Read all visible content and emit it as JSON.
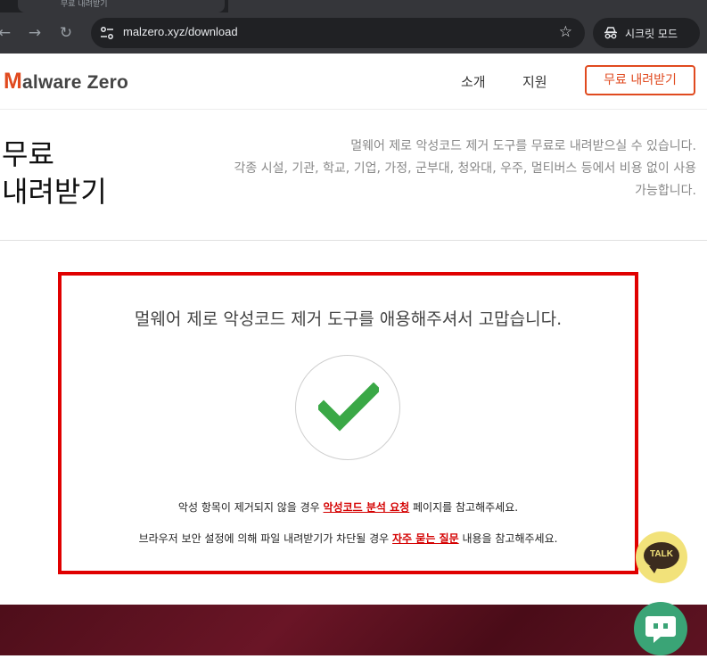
{
  "browser": {
    "tab_title": "무료 내려받기",
    "url": "malzero.xyz/download",
    "incognito_label": "시크릿 모드"
  },
  "header": {
    "logo_m": "M",
    "logo_alware": "alware",
    "logo_zero": "Zero",
    "nav_about": "소개",
    "nav_support": "지원",
    "download_button": "무료 내려받기"
  },
  "hero": {
    "title": "무료\n내려받기",
    "description": "멀웨어 제로 악성코드 제거 도구를 무료로 내려받으실 수 있습니다.\n각종 시설, 기관, 학교, 기업, 가정, 군부대, 청와대, 우주, 멀티버스 등에서 비용 없이 사용\n가능합니다."
  },
  "thanks": {
    "title": "멀웨어 제로 악성코드 제거 도구를 애용해주셔서 고맙습니다.",
    "notice1_pre": "악성 항목이 제거되지 않을 경우 ",
    "notice1_link": "악성코드 분석 요청",
    "notice1_post": " 페이지를 참고해주세요.",
    "notice2_pre": "브라우저 보안 설정에 의해 파일 내려받기가 차단될 경우 ",
    "notice2_link": "자주 묻는 질문",
    "notice2_post": " 내용을 참고해주세요."
  },
  "floating": {
    "talk_label": "TALK"
  },
  "colors": {
    "brand": "#e04a1f",
    "highlight_border": "#e00000",
    "check": "#3aa846",
    "link": "#d40000",
    "talk": "#f2e27a",
    "chat": "#3aa476"
  }
}
